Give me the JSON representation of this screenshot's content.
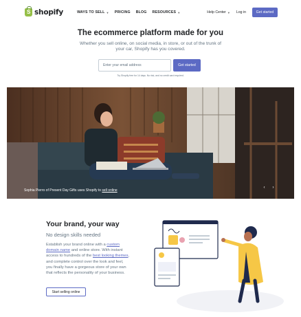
{
  "nav": {
    "brand": "shopify",
    "links": [
      {
        "label": "WAYS TO SELL",
        "dropdown": true
      },
      {
        "label": "PRICING",
        "dropdown": false
      },
      {
        "label": "BLOG",
        "dropdown": false
      },
      {
        "label": "RESOURCES",
        "dropdown": true
      }
    ],
    "help_center": "Help Center",
    "login": "Log in",
    "cta": "Get started"
  },
  "hero": {
    "title": "The ecommerce platform made for you",
    "subtitle": "Whether you sell online, on social media, in store, or out of the trunk of your car, Shopify has you covered.",
    "email_placeholder": "Enter your email address",
    "cta": "Get started",
    "note": "Try Shopify free for 14 days. No risk, and no credit card required."
  },
  "photo": {
    "caption_prefix": "Sophia Pierro of Present Day Gifts uses Shopify to ",
    "caption_link": "sell online",
    "prev_label": "‹",
    "next_label": "›"
  },
  "brand_section": {
    "title": "Your brand, your way",
    "subtitle": "No design skills needed",
    "body_1": "Establish your brand online with a ",
    "link_1": "custom domain name",
    "body_2": " and online store. With instant access to hundreds of the ",
    "link_2": "best looking themes",
    "body_3": ", and complete control over the look and feel, you finally have a gorgeous store of your own that reflects the personality of your business.",
    "cta": "Start selling online"
  },
  "colors": {
    "accent": "#5c6ac4",
    "logo_green": "#95bf47",
    "text": "#212326",
    "muted": "#637381"
  }
}
